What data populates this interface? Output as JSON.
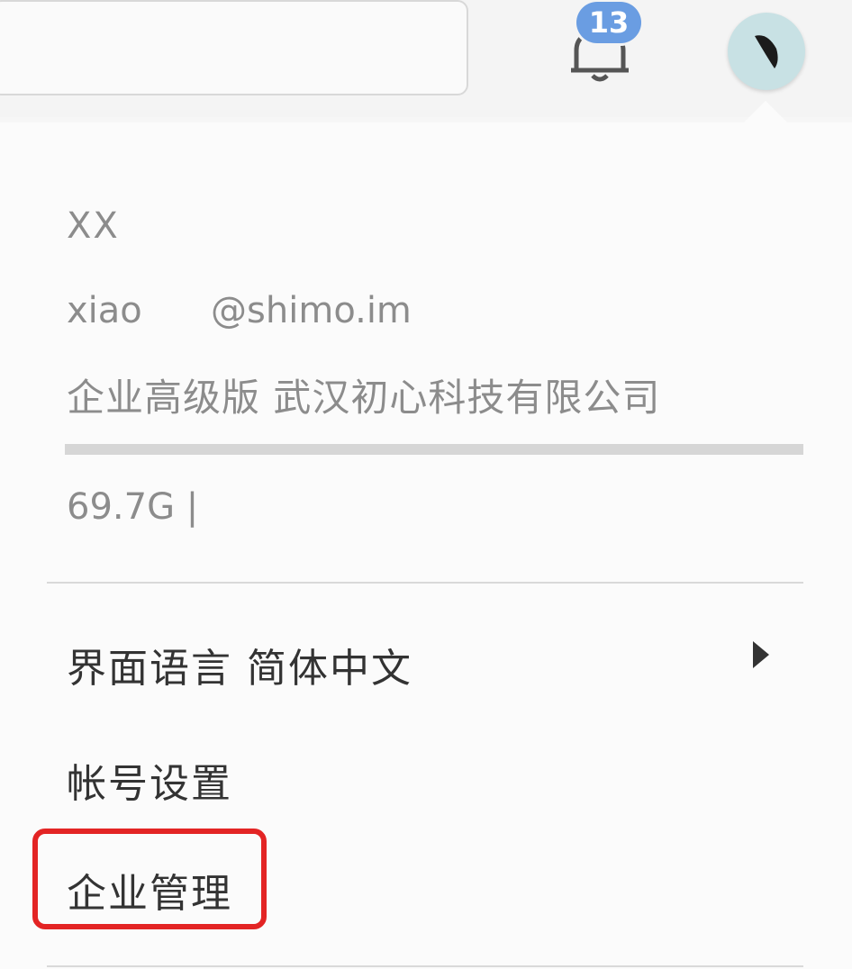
{
  "header": {
    "notification_count": "13"
  },
  "user": {
    "name": "XX",
    "email": "xiao      @shimo.im",
    "organization": "企业高级版 武汉初心科技有限公司",
    "storage_used": "69.7G |",
    "storage_fraction": 1.0
  },
  "menu": {
    "language_label": "界面语言 简体中文",
    "account_settings": "帐号设置",
    "enterprise_management": "企业管理"
  },
  "colors": {
    "badge": "#6a9de2",
    "avatar_bg": "#c8e1e4",
    "highlight": "#e32424"
  },
  "icons": {
    "bell": "bell-icon",
    "avatar": "avatar-icon",
    "arrow": "chevron-right-icon"
  }
}
